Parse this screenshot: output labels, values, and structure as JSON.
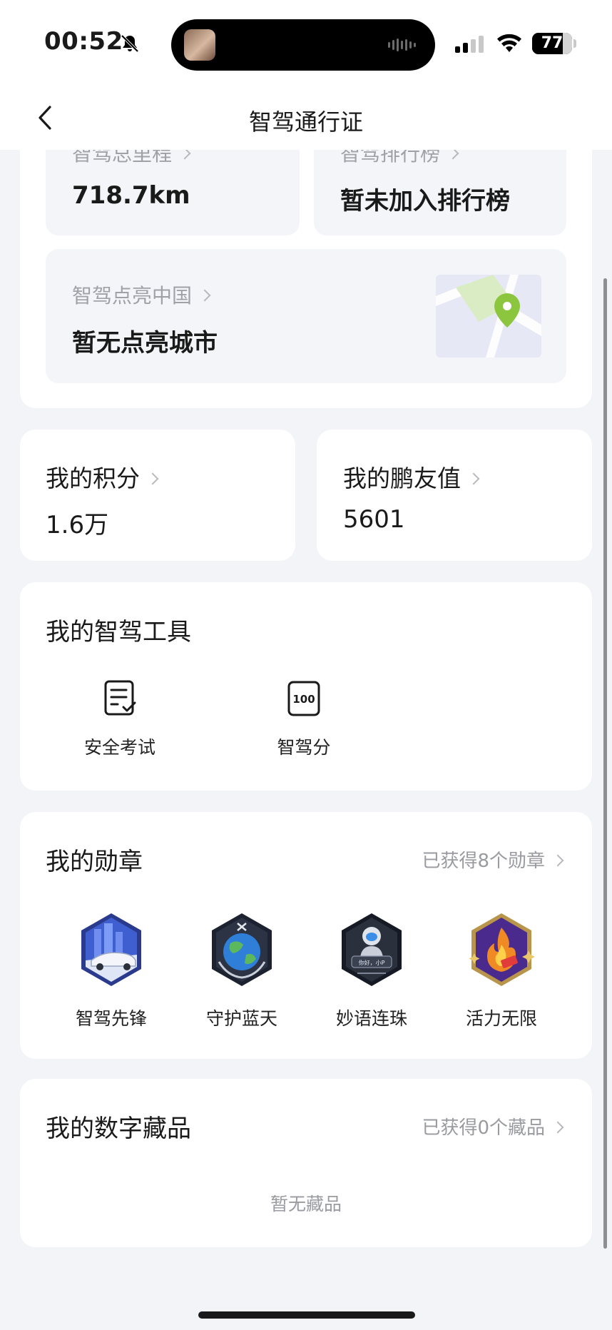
{
  "status_bar": {
    "time": "00:52",
    "battery": "77",
    "battery_level": 0.77
  },
  "nav": {
    "title": "智驾通行证"
  },
  "stats_top": {
    "mileage_label": "智驾总里程",
    "mileage_value": "718.7km",
    "ranking_label": "智驾排行榜",
    "ranking_value": "暂未加入排行榜",
    "light_china_label": "智驾点亮中国",
    "light_china_value": "暂无点亮城市"
  },
  "points": {
    "label": "我的积分",
    "value": "1.6万"
  },
  "friend_value": {
    "label": "我的鹏友值",
    "value": "5601"
  },
  "tools": {
    "title": "我的智驾工具",
    "items": [
      {
        "label": "安全考试",
        "icon": "exam-checklist-icon"
      },
      {
        "label": "智驾分",
        "icon": "score-100-icon",
        "icon_text": "100"
      }
    ]
  },
  "medals": {
    "title": "我的勋章",
    "summary": "已获得8个勋章",
    "items": [
      {
        "label": "智驾先锋",
        "icon": "car-city-medal-icon"
      },
      {
        "label": "守护蓝天",
        "icon": "earth-medal-icon"
      },
      {
        "label": "妙语连珠",
        "icon": "astronaut-medal-icon",
        "icon_text": "你好，小P"
      },
      {
        "label": "活力无限",
        "icon": "fire-medal-icon"
      }
    ]
  },
  "collectibles": {
    "title": "我的数字藏品",
    "summary": "已获得0个藏品",
    "empty_text": "暂无藏品"
  },
  "colors": {
    "background": "#f3f4f8",
    "card": "#ffffff",
    "muted": "#9a9ba0",
    "accent_green": "#8cc63f"
  }
}
